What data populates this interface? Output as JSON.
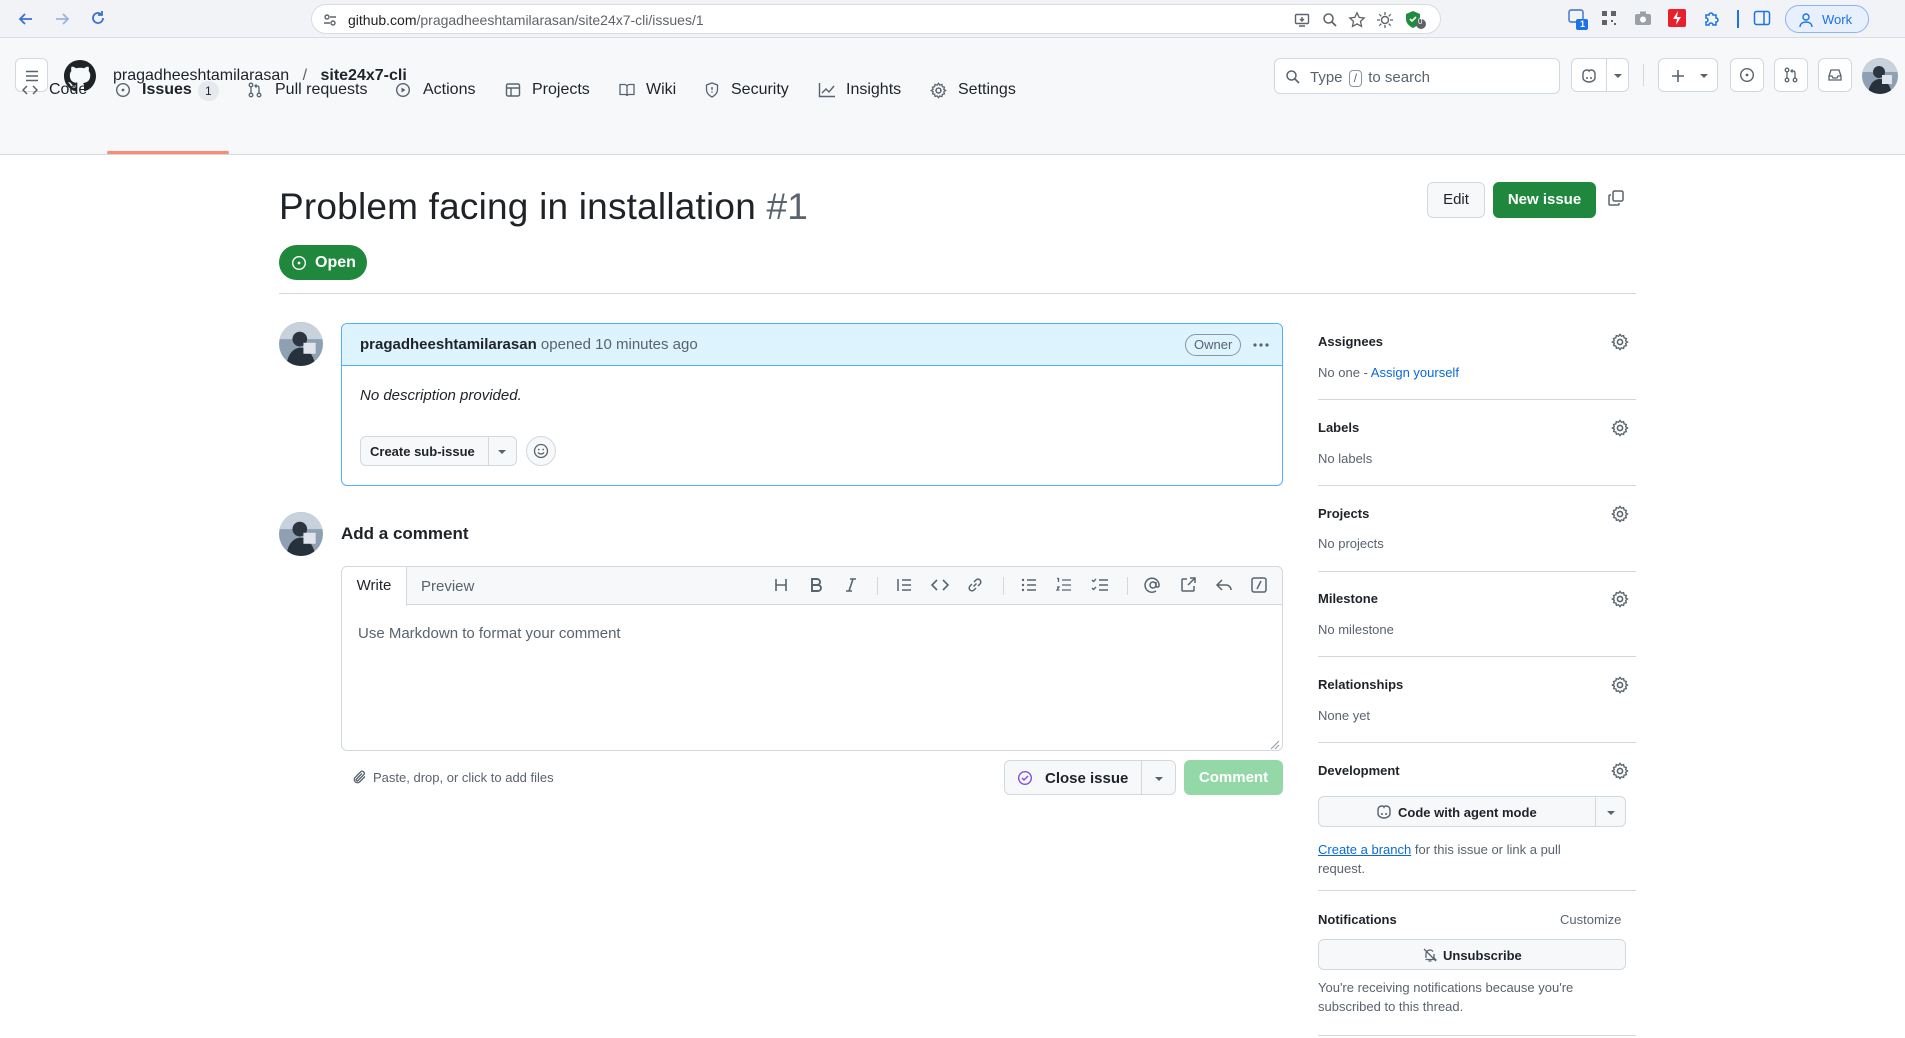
{
  "browser": {
    "url_host": "github.com",
    "url_path": "/pragadheeshtamilarasan/site24x7-cli/issues/1",
    "profile_label": "Work",
    "ext_badge_count": "1",
    "shield_badge": "0"
  },
  "repo": {
    "owner": "pragadheeshtamilarasan",
    "separator": "/",
    "name": "site24x7-cli"
  },
  "search": {
    "prefix": "Type",
    "key": "/",
    "suffix": "to search"
  },
  "tabs": [
    {
      "label": "Code",
      "icon": "code-icon"
    },
    {
      "label": "Issues",
      "icon": "issue-opened-icon",
      "count": "1"
    },
    {
      "label": "Pull requests",
      "icon": "git-pull-request-icon"
    },
    {
      "label": "Actions",
      "icon": "play-icon"
    },
    {
      "label": "Projects",
      "icon": "table-icon"
    },
    {
      "label": "Wiki",
      "icon": "book-icon"
    },
    {
      "label": "Security",
      "icon": "shield-icon"
    },
    {
      "label": "Insights",
      "icon": "graph-icon"
    },
    {
      "label": "Settings",
      "icon": "gear-icon"
    }
  ],
  "issue": {
    "title": "Problem facing in installation",
    "number": "#1",
    "state": "Open",
    "edit_label": "Edit",
    "new_issue_label": "New issue"
  },
  "comment_box": {
    "author": "pragadheeshtamilarasan",
    "action": "opened 10 minutes ago",
    "role_badge": "Owner",
    "body": "No description provided.",
    "sub_issue_label": "Create sub-issue"
  },
  "add_comment": {
    "heading": "Add a comment",
    "tab_write": "Write",
    "tab_preview": "Preview",
    "placeholder": "Use Markdown to format your comment",
    "attach_hint": "Paste, drop, or click to add files",
    "close_issue_label": "Close issue",
    "comment_label": "Comment"
  },
  "sidebar": {
    "assignees": {
      "title": "Assignees",
      "text": "No one -",
      "link": "Assign yourself"
    },
    "labels": {
      "title": "Labels",
      "text": "No labels"
    },
    "projects": {
      "title": "Projects",
      "text": "No projects"
    },
    "milestone": {
      "title": "Milestone",
      "text": "No milestone"
    },
    "relationships": {
      "title": "Relationships",
      "text": "None yet"
    },
    "development": {
      "title": "Development",
      "agent_button": "Code with agent mode",
      "link": "Create a branch",
      "text": "for this issue or link a pull request."
    },
    "notifications": {
      "title": "Notifications",
      "customize": "Customize",
      "unsubscribe": "Unsubscribe",
      "reason": "You're receiving notifications because you're subscribed to this thread."
    }
  },
  "colors": {
    "primary_green": "#1f883d",
    "link_blue": "#0969da",
    "tab_underline": "#fd8c73",
    "comment_header_bg": "#ddf4ff"
  }
}
